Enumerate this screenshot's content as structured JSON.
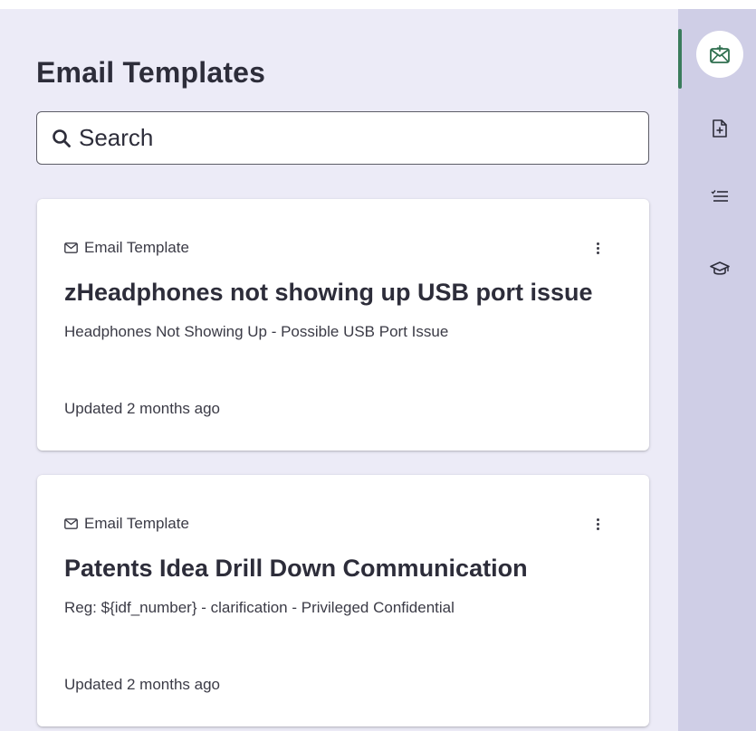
{
  "header": {
    "title": "Email Templates"
  },
  "search": {
    "placeholder": "Search",
    "value": ""
  },
  "templates": [
    {
      "type_label": "Email Template",
      "type_icon": "envelope-icon",
      "title": "zHeadphones not showing up USB port issue",
      "subject": "Headphones Not Showing Up - Possible USB Port Issue",
      "updated": "Updated 2 months ago"
    },
    {
      "type_label": "Email Template",
      "type_icon": "envelope-icon",
      "title": "Patents Idea Drill Down Communication",
      "subject": "Reg: ${idf_number} - clarification - Privileged Confidential",
      "updated": "Updated 2 months ago"
    }
  ],
  "rail": {
    "items": [
      {
        "icon": "email-template-icon",
        "active": true
      },
      {
        "icon": "add-document-icon",
        "active": false
      },
      {
        "icon": "checklist-icon",
        "active": false
      },
      {
        "icon": "graduation-cap-icon",
        "active": false
      }
    ]
  },
  "colors": {
    "panel_background": "#ecebf7",
    "rail_background": "#cfcee6",
    "accent": "#3a7c5c",
    "text": "#2d2d3a"
  }
}
